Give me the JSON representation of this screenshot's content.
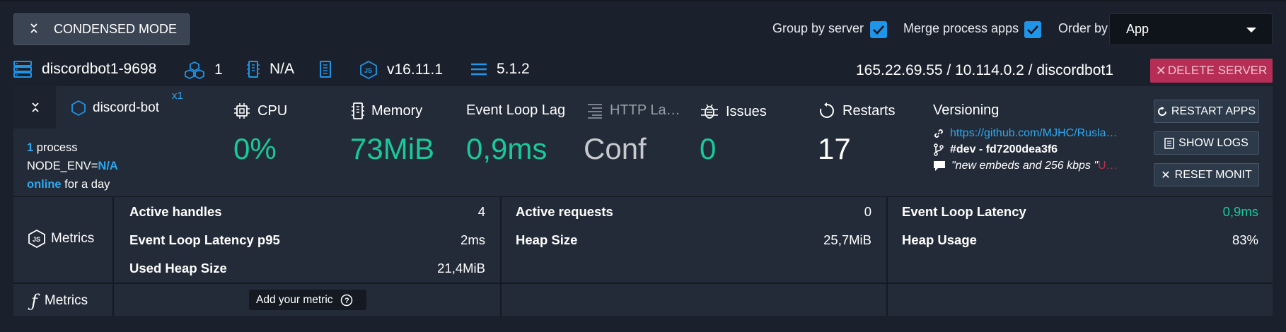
{
  "toolbar": {
    "condensed_label": "CONDENSED MODE",
    "group_by_label": "Group by server",
    "group_by_checked": true,
    "merge_label": "Merge process apps",
    "merge_checked": true,
    "order_by_label": "Order by",
    "order_by_value": "App"
  },
  "server": {
    "name": "discordbot1-9698",
    "process_count": "1",
    "memory_info": "N/A",
    "node_version": "v16.11.1",
    "agent_version": "5.1.2",
    "address": "165.22.69.55 / 10.114.0.2 / discordbot1",
    "delete_label": "DELETE SERVER"
  },
  "app": {
    "name": "discord-bot",
    "instances": "x1",
    "process_count": "1",
    "process_word": " process",
    "node_env_label": "NODE_ENV=",
    "node_env_value": "N/A",
    "status": "online",
    "uptime": " for a day"
  },
  "metrics": {
    "cpu": {
      "label": "CPU",
      "value": "0%"
    },
    "memory": {
      "label": "Memory",
      "value": "73MiB"
    },
    "event_loop_lag": {
      "label": "Event Loop Lag",
      "value": "0,9ms"
    },
    "http_latency": {
      "label": "HTTP La…",
      "value": "Conf"
    },
    "issues": {
      "label": "Issues",
      "value": "0"
    },
    "restarts": {
      "label": "Restarts",
      "value": "17"
    }
  },
  "versioning": {
    "label": "Versioning",
    "url": "https://github.com/MJHC/Rusla…",
    "branch": "#dev - fd7200dea3f6",
    "commit_msg": "\"new embeds and 256 kbps \"",
    "commit_tail": " U…"
  },
  "actions": {
    "restart": "RESTART APPS",
    "logs": "SHOW LOGS",
    "reset": "RESET MONIT"
  },
  "metric_rows": {
    "node_label": "Metrics",
    "custom_label": "Metrics",
    "add_metric": "Add your metric",
    "col1": [
      {
        "key": "Active handles",
        "value": "4"
      },
      {
        "key": "Event Loop Latency p95",
        "value": "2ms"
      },
      {
        "key": "Used Heap Size",
        "value": "21,4MiB"
      }
    ],
    "col2": [
      {
        "key": "Active requests",
        "value": "0"
      },
      {
        "key": "Heap Size",
        "value": "25,7MiB"
      }
    ],
    "col3": [
      {
        "key": "Event Loop Latency",
        "value": "0,9ms"
      },
      {
        "key": "Heap Usage",
        "value": "83%"
      }
    ]
  },
  "colors": {
    "accent_blue": "#1e95e8",
    "accent_green": "#18c99b",
    "danger": "#b62e56",
    "background": "#1b212c",
    "panel": "#222b37"
  }
}
